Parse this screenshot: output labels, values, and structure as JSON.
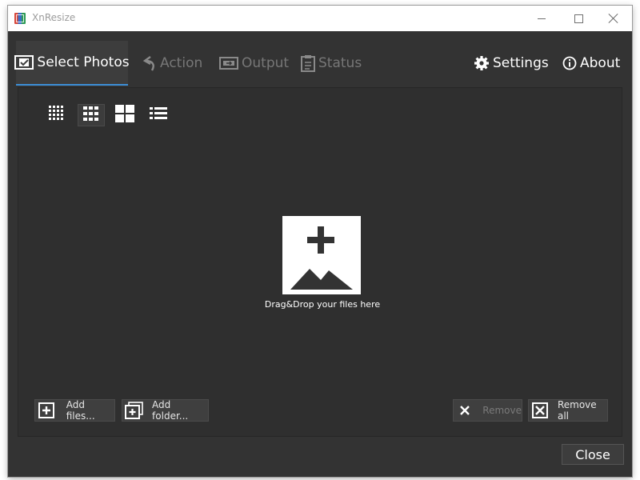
{
  "window": {
    "title": "XnResize"
  },
  "tabs": [
    {
      "label": "Select Photos",
      "icon": "select-photos-icon"
    },
    {
      "label": "Action",
      "icon": "action-icon"
    },
    {
      "label": "Output",
      "icon": "output-icon"
    },
    {
      "label": "Status",
      "icon": "status-icon"
    }
  ],
  "header_links": [
    {
      "label": "Settings",
      "icon": "gear-icon"
    },
    {
      "label": "About",
      "icon": "info-icon"
    }
  ],
  "view_modes": [
    "small-grid-view",
    "medium-grid-view",
    "large-grid-view",
    "list-view"
  ],
  "dropzone": {
    "label": "Drag&Drop your files here",
    "icon": "add-image-icon"
  },
  "buttons": {
    "add_files": "Add files...",
    "add_folder": "Add folder...",
    "remove": "Remove",
    "remove_all": "Remove all",
    "close": "Close"
  },
  "colors": {
    "accent": "#3d8fd8",
    "background": "#333333",
    "panel": "#2f2f2f"
  }
}
